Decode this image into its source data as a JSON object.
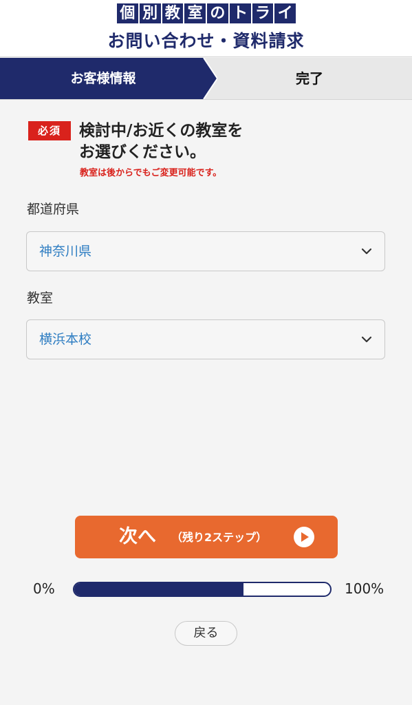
{
  "header": {
    "logo_chars": [
      "個",
      "別",
      "教",
      "室",
      "の",
      "ト",
      "ラ",
      "イ"
    ],
    "title": "お問い合わせ・資料請求"
  },
  "steps": {
    "active_label": "お客様情報",
    "done_label": "完了"
  },
  "question": {
    "required_badge": "必須",
    "text": "検討中/お近くの教室を\nお選びください。",
    "note": "教室は後からでもご変更可能です。"
  },
  "fields": {
    "prefecture": {
      "label": "都道府県",
      "value": "神奈川県"
    },
    "school": {
      "label": "教室",
      "value": "横浜本校"
    }
  },
  "next_button": {
    "main": "次へ",
    "sub": "（残り2ステップ）"
  },
  "progress": {
    "start_label": "0%",
    "end_label": "100%",
    "fraction": 0.66
  },
  "back_button": {
    "label": "戻る"
  },
  "colors": {
    "brand_navy": "#1f2a6b",
    "accent_orange": "#e8692f",
    "required_red": "#d9221c",
    "select_text_blue": "#2e7dc2"
  },
  "icons": {
    "select_chevron": "chevron-down-icon",
    "next_play": "play-circle-icon"
  }
}
